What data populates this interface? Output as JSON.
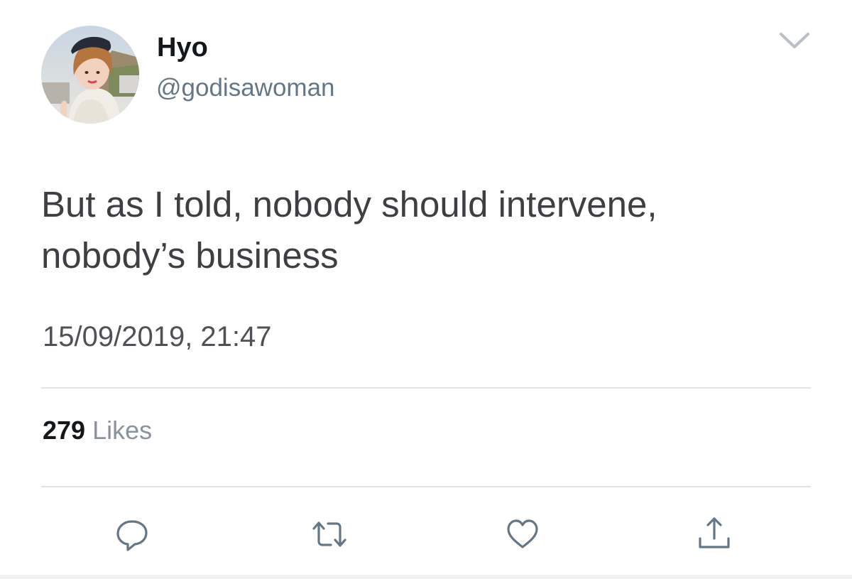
{
  "user": {
    "display_name": "Hyo",
    "handle": "@godisawoman"
  },
  "tweet": {
    "text_line1": "But as I told, nobody should intervene,",
    "text_line2": "nobody’s business",
    "timestamp": "15/09/2019, 21:47"
  },
  "stats": {
    "likes_count": "279",
    "likes_label": "Likes"
  },
  "icons": {
    "menu": "chevron-down-icon",
    "reply": "reply-icon",
    "retweet": "retweet-icon",
    "like": "heart-icon",
    "share": "share-icon"
  },
  "colors": {
    "text_primary": "#14171a",
    "text_secondary": "#657786",
    "tweet_text": "#3d3f42",
    "icon_gray": "#657786",
    "divider": "#e1e4e7"
  }
}
